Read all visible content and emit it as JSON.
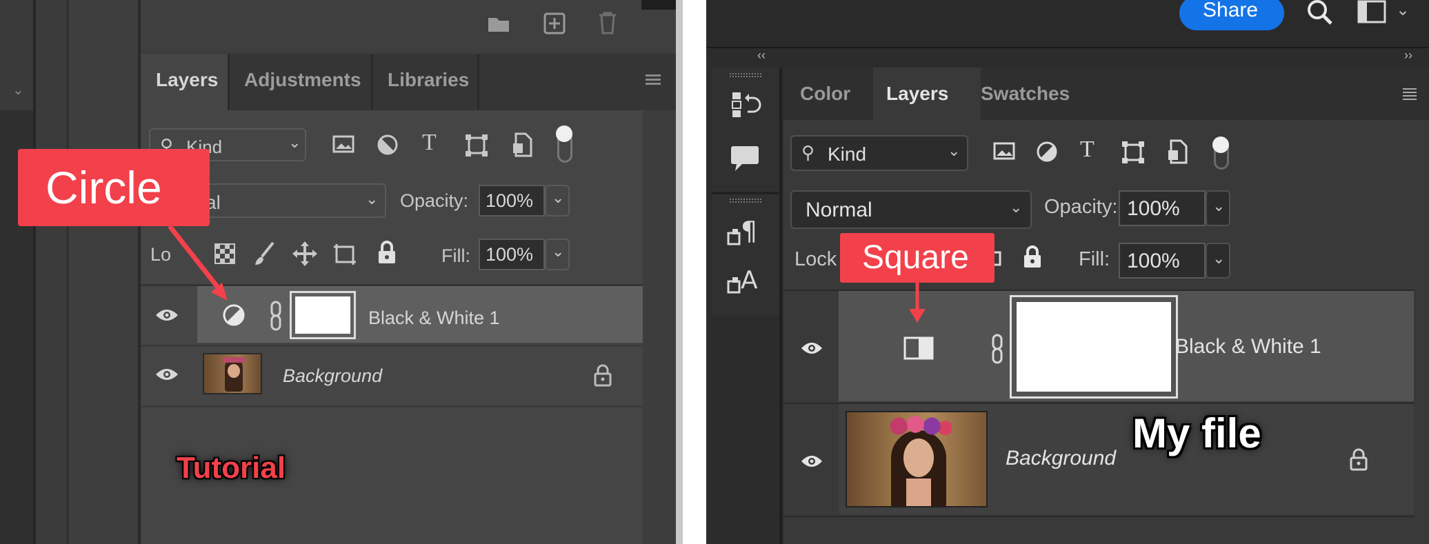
{
  "left": {
    "tabs": [
      "Layers",
      "Adjustments",
      "Libraries"
    ],
    "kind_label": "Kind",
    "blend_mode_partial": "al",
    "opacity_label": "Opacity:",
    "opacity_value": "100%",
    "lock_label_partial": "Lo",
    "fill_label": "Fill:",
    "fill_value": "100%",
    "layers": [
      {
        "name": "Black & White 1",
        "type": "adjustment",
        "selected": true
      },
      {
        "name": "Background",
        "type": "image",
        "locked": true
      }
    ],
    "callout": "Circle",
    "watermark": "Tutorial"
  },
  "right": {
    "share_button": "Share",
    "tabs": [
      "Color",
      "Layers",
      "Swatches"
    ],
    "active_tab": "Layers",
    "kind_label": "Kind",
    "blend_mode": "Normal",
    "opacity_label": "Opacity:",
    "opacity_value": "100%",
    "lock_label": "Lock",
    "fill_label": "Fill:",
    "fill_value": "100%",
    "layers": [
      {
        "name": "Black & White 1",
        "type": "adjustment",
        "selected": true
      },
      {
        "name": "Background",
        "type": "image",
        "locked": true
      }
    ],
    "callout": "Square",
    "watermark": "My file"
  },
  "colors": {
    "callout_red": "#f2414b",
    "share_blue": "#1473e6",
    "panel_bg": "#3d3d3d",
    "selected_row": "#5f5f5f"
  }
}
